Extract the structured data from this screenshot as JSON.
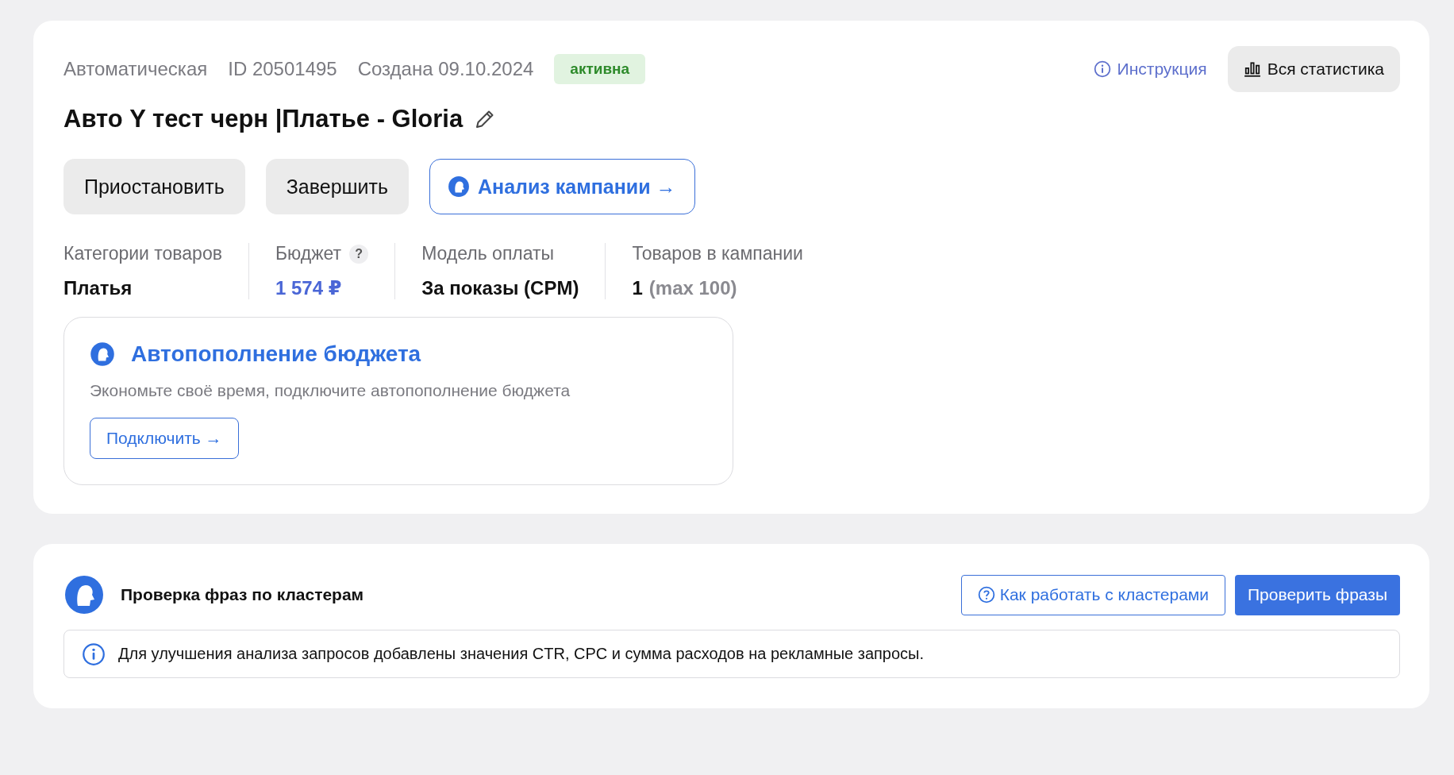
{
  "campaign": {
    "type": "Автоматическая",
    "id": "ID 20501495",
    "created": "Создана 09.10.2024",
    "status": {
      "label": "активна",
      "kind": "active"
    },
    "title": "Авто Y тест черн |Платье - Gloria",
    "instruction_link": "Инструкция",
    "stats_button": "Вся статистика",
    "actions": [
      {
        "label": "Приостановить",
        "kind": "secondary"
      },
      {
        "label": "Завершить",
        "kind": "secondary"
      },
      {
        "label": "Анализ кампании →",
        "kind": "outline"
      }
    ],
    "stats": [
      {
        "label": "Категории товаров",
        "value": "Платья",
        "kind": "text"
      },
      {
        "label": "Бюджет",
        "help": "?",
        "value": "1 574 ₽",
        "kind": "link"
      },
      {
        "label": "Модель оплаты",
        "value": "За показы (CPM)",
        "kind": "text"
      },
      {
        "label": "Товаров в кампании",
        "value": "1",
        "note": "(max 100)",
        "kind": "text"
      }
    ],
    "autofill": {
      "title": "Автопополнение бюджета",
      "text": "Экономьте своё время, подключите автопополнение бюджета",
      "button": "Подключить →"
    }
  },
  "clusters": {
    "title": "Проверка фраз по кластерам",
    "help_button": "Как работать с кластерами",
    "check_button": "Проверить фразы",
    "notice": "Для улучшения анализа запросов добавлены значения CTR, CPC и сумма расходов на рекламные запросы."
  }
}
